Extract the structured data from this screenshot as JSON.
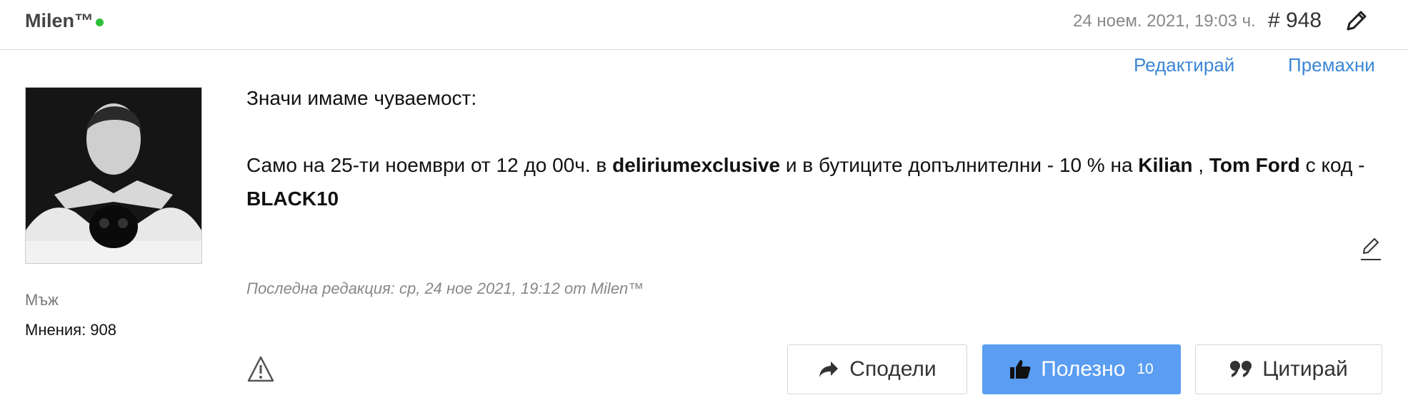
{
  "header": {
    "author": "Milen™",
    "date": "24 ноем. 2021, 19:03 ч.",
    "post_number": "# 948"
  },
  "actions": {
    "edit": "Редактирай",
    "remove": "Премахни"
  },
  "author_info": {
    "gender": "Мъж",
    "posts": "Мнения: 908"
  },
  "content": {
    "line1": "Значи имаме чуваемост:",
    "p2_a": "Само на 25-ти ноември от 12 до 00ч. в ",
    "p2_b": "deliriumexclusive",
    "p2_c": "  и в бутиците допълнителни - 10 % на ",
    "p2_d": "Kilian",
    "p2_e": " , ",
    "p2_f": "Tom Ford",
    "p2_g": " с код - ",
    "p2_h": "BLACK10"
  },
  "last_edit": "Последна редакция: ср, 24 ное 2021, 19:12 от Milen™",
  "buttons": {
    "share": "Сподели",
    "useful": "Полезно",
    "useful_count": "10",
    "quote": "Цитирай"
  },
  "colors": {
    "link": "#3a86d6",
    "useful_button": "#5a9df2",
    "online": "#2fbf3a"
  },
  "icons": [
    "pencil-icon",
    "edit-pencil-icon",
    "warning-icon",
    "share-arrow-icon",
    "thumbs-up-icon",
    "quote-icon"
  ]
}
